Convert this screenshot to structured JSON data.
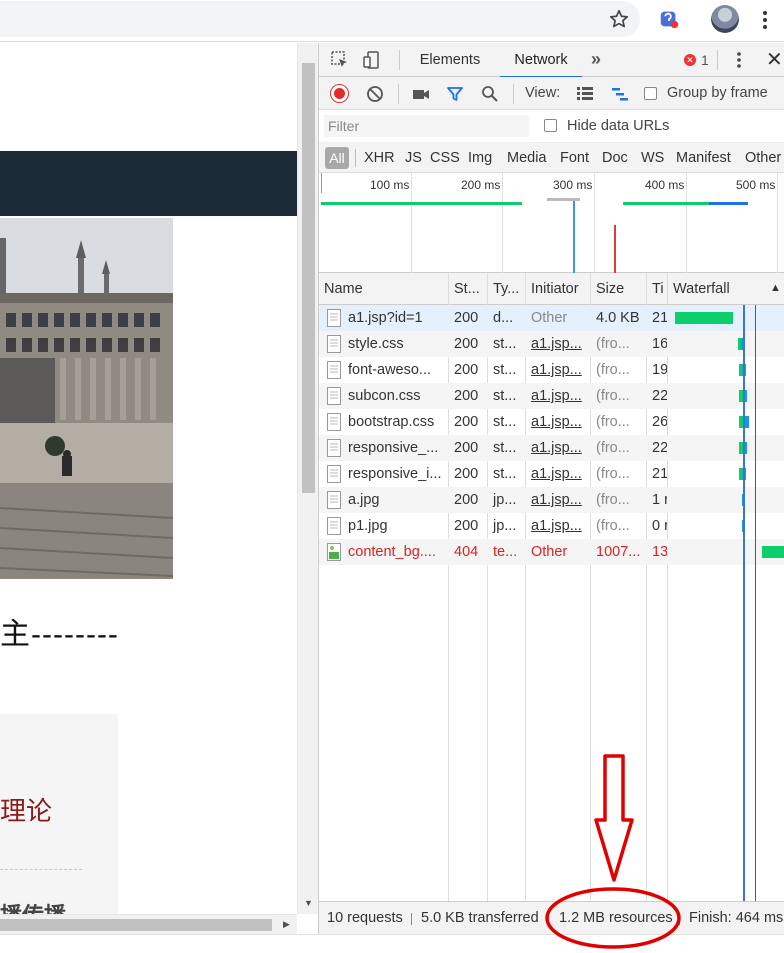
{
  "browser": {
    "icons": {
      "star": "star-icon",
      "extension": "extension-icon",
      "avatar": "profile-avatar",
      "menu": "kebab-menu-icon"
    }
  },
  "page": {
    "hero_text": "主--------",
    "panel_red_text": "理论",
    "panel_bottom_text": "播传播"
  },
  "devtools": {
    "tabs": [
      {
        "label": "Elements",
        "active": false
      },
      {
        "label": "Network",
        "active": true
      }
    ],
    "more_tabs": "»",
    "error_count": "1",
    "toolbar": {
      "view_label": "View:",
      "group_by_frame": "Group by frame"
    },
    "filter": {
      "placeholder": "Filter",
      "value": "",
      "hide_data_urls": "Hide data URLs"
    },
    "types": [
      "All",
      "XHR",
      "JS",
      "CSS",
      "Img",
      "Media",
      "Font",
      "Doc",
      "WS",
      "Manifest",
      "Other"
    ],
    "overview_ticks": [
      "100 ms",
      "200 ms",
      "300 ms",
      "400 ms",
      "500 ms"
    ],
    "columns": {
      "name": "Name",
      "status": "St...",
      "type": "Ty...",
      "initiator": "Initiator",
      "size": "Size",
      "time": "Ti",
      "waterfall": "Waterfall"
    },
    "requests": [
      {
        "name": "a1.jsp?id=1",
        "status": "200",
        "type": "d...",
        "initiator": "Other",
        "size": "4.0 KB",
        "time": "21",
        "waterfall_start_ms": 0,
        "waterfall_dur_ms": 50
      },
      {
        "name": "style.css",
        "status": "200",
        "type": "st...",
        "initiator": "a1.jsp...",
        "size": "(fro...",
        "time": "16",
        "waterfall_start_ms": 55,
        "waterfall_dur_ms": 5
      },
      {
        "name": "font-aweso...",
        "status": "200",
        "type": "st...",
        "initiator": "a1.jsp...",
        "size": "(fro...",
        "time": "19",
        "waterfall_start_ms": 56,
        "waterfall_dur_ms": 6
      },
      {
        "name": "subcon.css",
        "status": "200",
        "type": "st...",
        "initiator": "a1.jsp...",
        "size": "(fro...",
        "time": "22",
        "waterfall_start_ms": 56,
        "waterfall_dur_ms": 7
      },
      {
        "name": "bootstrap.css",
        "status": "200",
        "type": "st...",
        "initiator": "a1.jsp...",
        "size": "(fro...",
        "time": "26",
        "waterfall_start_ms": 56,
        "waterfall_dur_ms": 8
      },
      {
        "name": "responsive_...",
        "status": "200",
        "type": "st...",
        "initiator": "a1.jsp...",
        "size": "(fro...",
        "time": "22",
        "waterfall_start_ms": 56,
        "waterfall_dur_ms": 7
      },
      {
        "name": "responsive_i...",
        "status": "200",
        "type": "st...",
        "initiator": "a1.jsp...",
        "size": "(fro...",
        "time": "21",
        "waterfall_start_ms": 56,
        "waterfall_dur_ms": 6
      },
      {
        "name": "a.jpg",
        "status": "200",
        "type": "jp...",
        "initiator": "a1.jsp...",
        "size": "(fro...",
        "time": "1 r",
        "waterfall_start_ms": 58,
        "waterfall_dur_ms": 2
      },
      {
        "name": "p1.jpg",
        "status": "200",
        "type": "jp...",
        "initiator": "a1.jsp...",
        "size": "(fro...",
        "time": "0 r",
        "waterfall_start_ms": 58,
        "waterfall_dur_ms": 2
      },
      {
        "name": "content_bg....",
        "status": "404",
        "type": "te...",
        "initiator": "Other",
        "size": "1007...",
        "time": "13",
        "waterfall_start_ms": 76,
        "waterfall_dur_ms": 30,
        "error": true
      }
    ],
    "status_bar": {
      "requests": "10 requests",
      "transferred": "5.0 KB transferred",
      "resources": "1.2 MB resources",
      "finish": "Finish: 464 ms."
    },
    "colors": {
      "accent": "#1a73e8",
      "record": "#e52a2a",
      "error_text": "#dd2222",
      "waterfall_green": "#0cce6b",
      "annotation_red": "#e00000"
    }
  }
}
